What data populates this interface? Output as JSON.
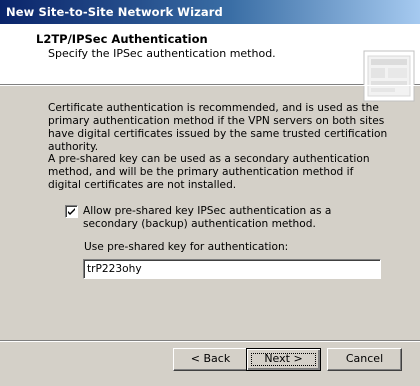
{
  "window": {
    "title": "New Site-to-Site Network Wizard"
  },
  "header": {
    "title": "L2TP/IPSec Authentication",
    "subtitle": "Specify the IPSec authentication method.",
    "icon": "wizard-page-icon"
  },
  "body": {
    "paragraph1": "Certificate authentication is recommended, and is used as the primary authentication method if the VPN servers on both sites have digital certificates issued by the same trusted certification authority.",
    "paragraph2": "A pre-shared key can be used as a secondary authentication method, and will be the primary authentication method if digital certificates are not installed.",
    "checkbox": {
      "label": "Allow pre-shared key IPSec authentication as a secondary (backup) authentication method.",
      "checked": true
    },
    "key_field": {
      "label": "Use pre-shared key for authentication:",
      "value": "trP223ohy"
    }
  },
  "buttons": {
    "back": "< Back",
    "next": "Next >",
    "cancel": "Cancel"
  },
  "colors": {
    "titlebar_start": "#0a246a",
    "titlebar_end": "#a6caf0",
    "dialog_face": "#d4d0c8"
  }
}
